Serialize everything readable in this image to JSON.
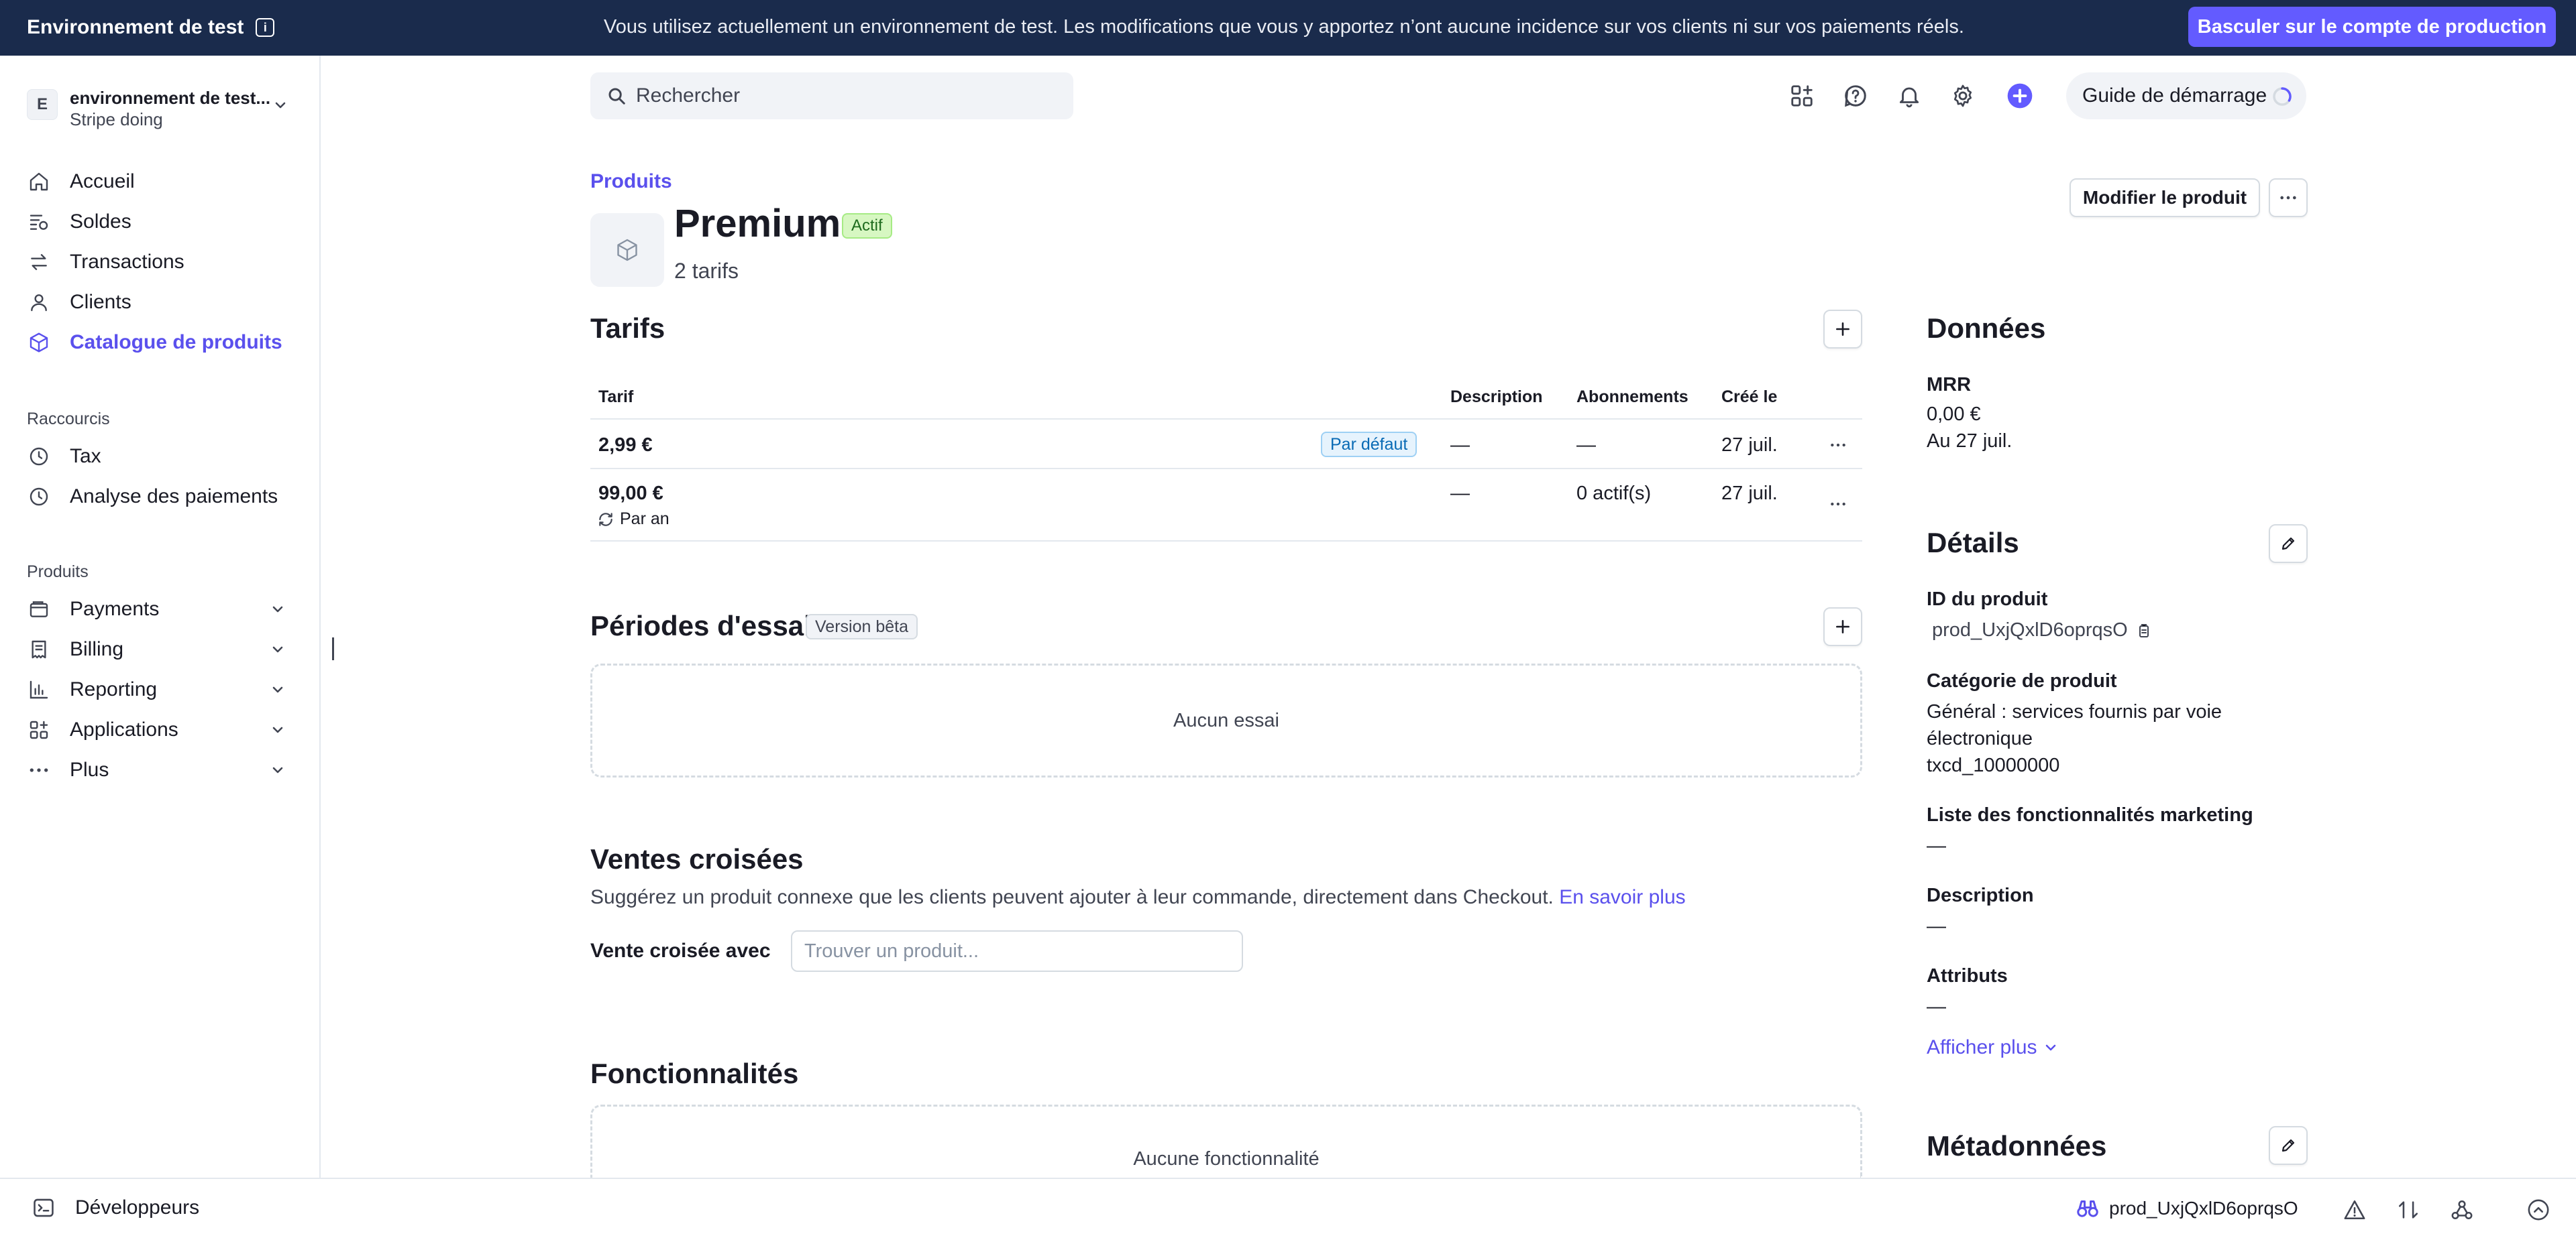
{
  "banner": {
    "title": "Environnement de test",
    "message": "Vous utilisez actuellement un environnement de test. Les modifications que vous y apportez n’ont aucune incidence sur vos clients ni sur vos paiements réels.",
    "switch_button": "Basculer sur le compte de production"
  },
  "account": {
    "initial": "E",
    "name": "environnement de test...",
    "subtitle": "Stripe doing"
  },
  "sidebar": {
    "main_items": [
      {
        "label": "Accueil",
        "icon": "home-icon"
      },
      {
        "label": "Soldes",
        "icon": "balance-icon"
      },
      {
        "label": "Transactions",
        "icon": "arrows-icon"
      },
      {
        "label": "Clients",
        "icon": "person-icon"
      },
      {
        "label": "Catalogue de produits",
        "icon": "box-icon",
        "active": true
      }
    ],
    "shortcuts_title": "Raccourcis",
    "shortcuts": [
      {
        "label": "Tax",
        "icon": "clock-icon"
      },
      {
        "label": "Analyse des paiements",
        "icon": "clock-icon"
      }
    ],
    "products_title": "Produits",
    "products": [
      {
        "label": "Payments",
        "icon": "wallet-icon"
      },
      {
        "label": "Billing",
        "icon": "billing-icon"
      },
      {
        "label": "Reporting",
        "icon": "chart-icon"
      },
      {
        "label": "Applications",
        "icon": "apps-icon"
      },
      {
        "label": "Plus",
        "icon": "more-icon"
      }
    ]
  },
  "toolbar": {
    "search_placeholder": "Rechercher",
    "guide_label": "Guide de démarrage"
  },
  "product": {
    "breadcrumb": "Produits",
    "name": "Premium",
    "status": "Actif",
    "price_count": "2 tarifs",
    "edit_button": "Modifier le produit"
  },
  "prices": {
    "title": "Tarifs",
    "headers": [
      "Tarif",
      "Description",
      "Abonnements",
      "Créé le"
    ],
    "rows": [
      {
        "amount": "2,99 €",
        "badge": "Par défaut",
        "description": "—",
        "subscriptions": "—",
        "created": "27 juil."
      },
      {
        "amount": "99,00 €",
        "interval": "Par an",
        "description": "—",
        "subscriptions": "0 actif(s)",
        "created": "27 juil."
      }
    ]
  },
  "trials": {
    "title": "Périodes d'essai",
    "badge": "Version bêta",
    "empty": "Aucun essai"
  },
  "cross_sell": {
    "title": "Ventes croisées",
    "description": "Suggérez un produit connexe que les clients peuvent ajouter à leur commande, directement dans Checkout.",
    "link": "En savoir plus",
    "label": "Vente croisée avec",
    "placeholder": "Trouver un produit..."
  },
  "features": {
    "title": "Fonctionnalités",
    "empty": "Aucune fonctionnalité"
  },
  "data_panel": {
    "title": "Données",
    "mrr_label": "MRR",
    "mrr_value": "0,00 €",
    "mrr_date": "Au 27 juil."
  },
  "details": {
    "title": "Détails",
    "id_label": "ID du produit",
    "id_value": "prod_UxjQxlD6oprqsO",
    "category_label": "Catégorie de produit",
    "category_line1": "Général : services fournis par voie",
    "category_line2": "électronique",
    "category_code": "txcd_10000000",
    "marketing_label": "Liste des fonctionnalités marketing",
    "marketing_value": "—",
    "description_label": "Description",
    "description_value": "—",
    "attributes_label": "Attributs",
    "attributes_value": "—",
    "show_more": "Afficher plus"
  },
  "metadata": {
    "title": "Métadonnées"
  },
  "bottombar": {
    "developers": "Développeurs",
    "object_id": "prod_UxjQxlD6oprqsO"
  },
  "colors": {
    "banner": "#1a2b4c",
    "accent": "#635bff",
    "link": "#5a50ed"
  }
}
